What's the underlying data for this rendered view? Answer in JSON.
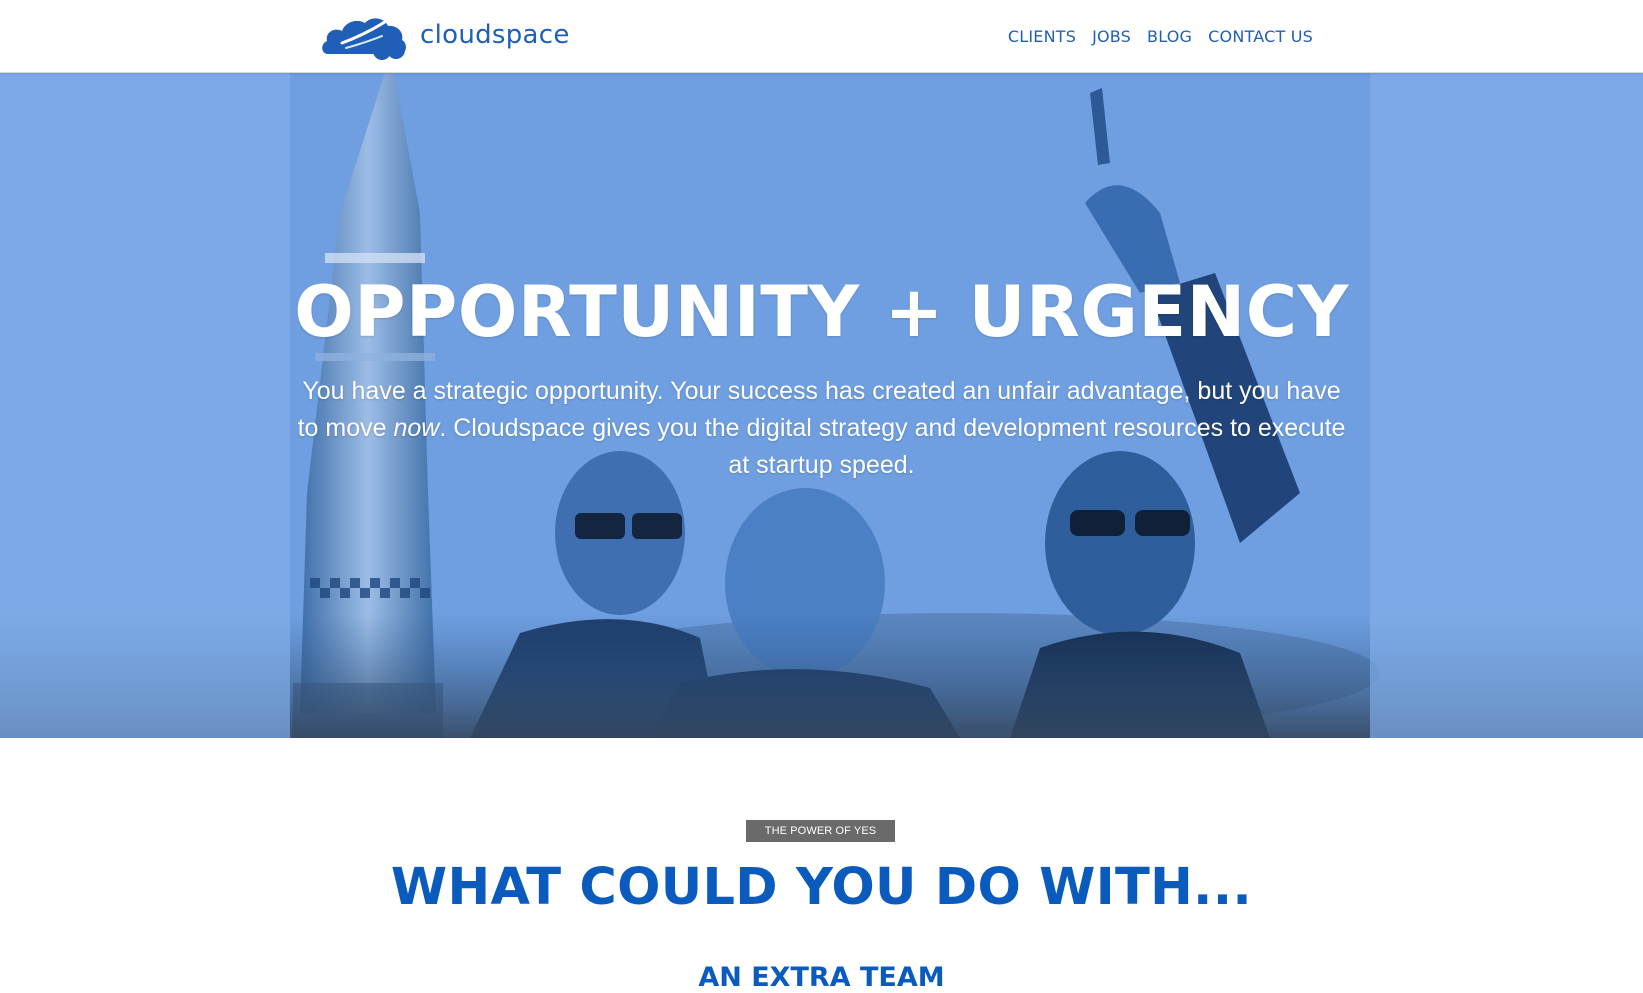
{
  "header": {
    "logo_text": "cloudspace",
    "nav": [
      "CLIENTS",
      "JOBS",
      "BLOG",
      "CONTACT US"
    ]
  },
  "hero": {
    "title": "OPPORTUNITY + URGENCY",
    "text_before": "You have a strategic opportunity. Your success has created an unfair advantage, but you have to move ",
    "text_emphasis": "now",
    "text_after": ". Cloudspace gives you the digital strategy and development resources to execute at startup speed."
  },
  "section": {
    "badge": "THE POWER OF YES",
    "title": "WHAT COULD YOU DO WITH...",
    "subtitle": "AN EXTRA TEAM"
  },
  "colors": {
    "brand_blue": "#1f5fb8",
    "heading_blue": "#0a5bbd",
    "hero_tint": "#7eaae6",
    "badge_gray": "#6a6a6a"
  },
  "icons": [
    "cloud-rocket-logo-icon"
  ]
}
